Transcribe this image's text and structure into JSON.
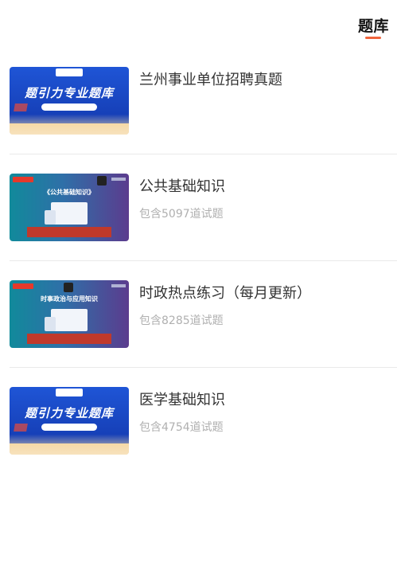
{
  "header": {
    "tab_label": "题库",
    "accent_color": "#f0643c"
  },
  "items": [
    {
      "title": "兰州事业单位招聘真题",
      "count_text": "",
      "thumbnail": {
        "style": "blue-brand",
        "headline": "题引力专业题库"
      }
    },
    {
      "title": "公共基础知识",
      "count_text": "包含5097道试题",
      "thumbnail": {
        "style": "gradient-screen",
        "headline": "《公共基础知识》"
      }
    },
    {
      "title": "时政热点练习（每月更新）",
      "count_text": "包含8285道试题",
      "thumbnail": {
        "style": "gradient-screen",
        "headline": "时事政治与应用知识"
      }
    },
    {
      "title": "医学基础知识",
      "count_text": "包含4754道试题",
      "thumbnail": {
        "style": "blue-brand",
        "headline": "题引力专业题库"
      }
    }
  ]
}
